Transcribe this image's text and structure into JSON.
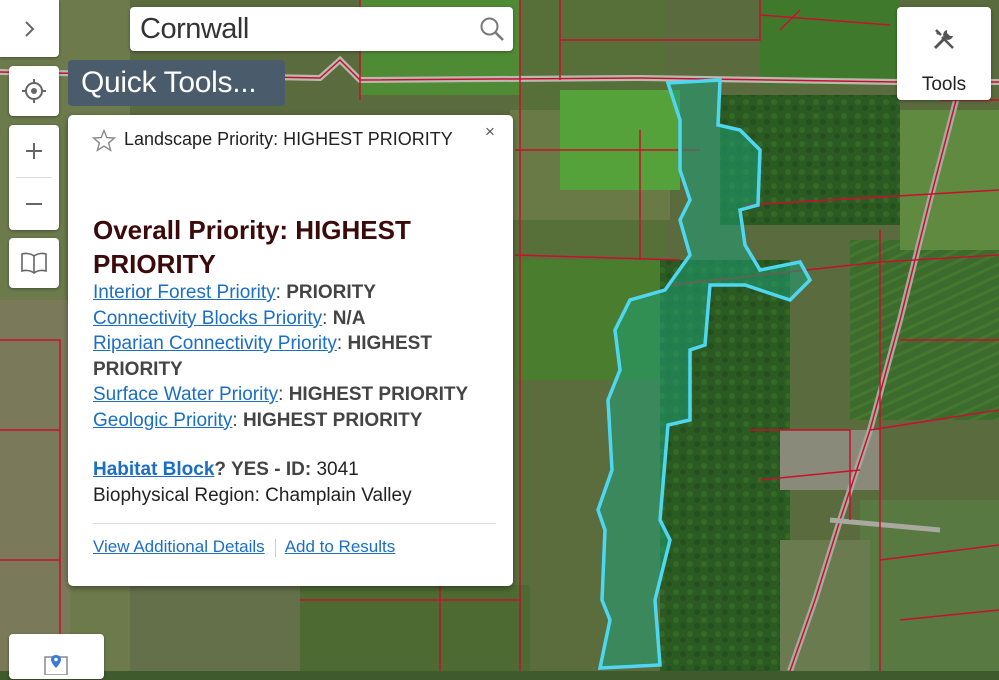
{
  "search": {
    "value": "Cornwall"
  },
  "quick_tools": {
    "label": "Quick Tools..."
  },
  "tools": {
    "label": "Tools"
  },
  "popup": {
    "close_glyph": "×",
    "header": "Landscape Priority: HIGHEST PRIORITY",
    "overall": "Overall Priority: HIGHEST PRIORITY",
    "rows": [
      {
        "link": "Interior Forest Priority",
        "value": "PRIORITY"
      },
      {
        "link": "Connectivity Blocks Priority",
        "value": "N/A"
      },
      {
        "link": "Riparian Connectivity Priority",
        "value": "HIGHEST PRIORITY"
      },
      {
        "link": "Surface Water Priority",
        "value": "HIGHEST PRIORITY"
      },
      {
        "link": "Geologic Priority",
        "value": "HIGHEST PRIORITY"
      }
    ],
    "habitat": {
      "link": "Habitat Block",
      "answer": "? YES - ID:",
      "id": "3041",
      "region": "Biophysical Region: Champlain Valley"
    },
    "actions": {
      "details": "View Additional Details",
      "add": "Add to Results"
    }
  },
  "colors": {
    "popup_title": "#3b0a0a",
    "link": "#1a6fc4",
    "parcel_line": "#c8102e",
    "selection_outline": "#4fd7f2",
    "selection_fill": "#1f9e74",
    "quick_tools_bg": "#4a5c6c"
  },
  "icons": [
    "chevron-right-icon",
    "locate-icon",
    "plus-icon",
    "minus-icon",
    "book-icon",
    "search-icon",
    "tools-icon",
    "star-icon",
    "close-icon",
    "map-pin-icon"
  ]
}
